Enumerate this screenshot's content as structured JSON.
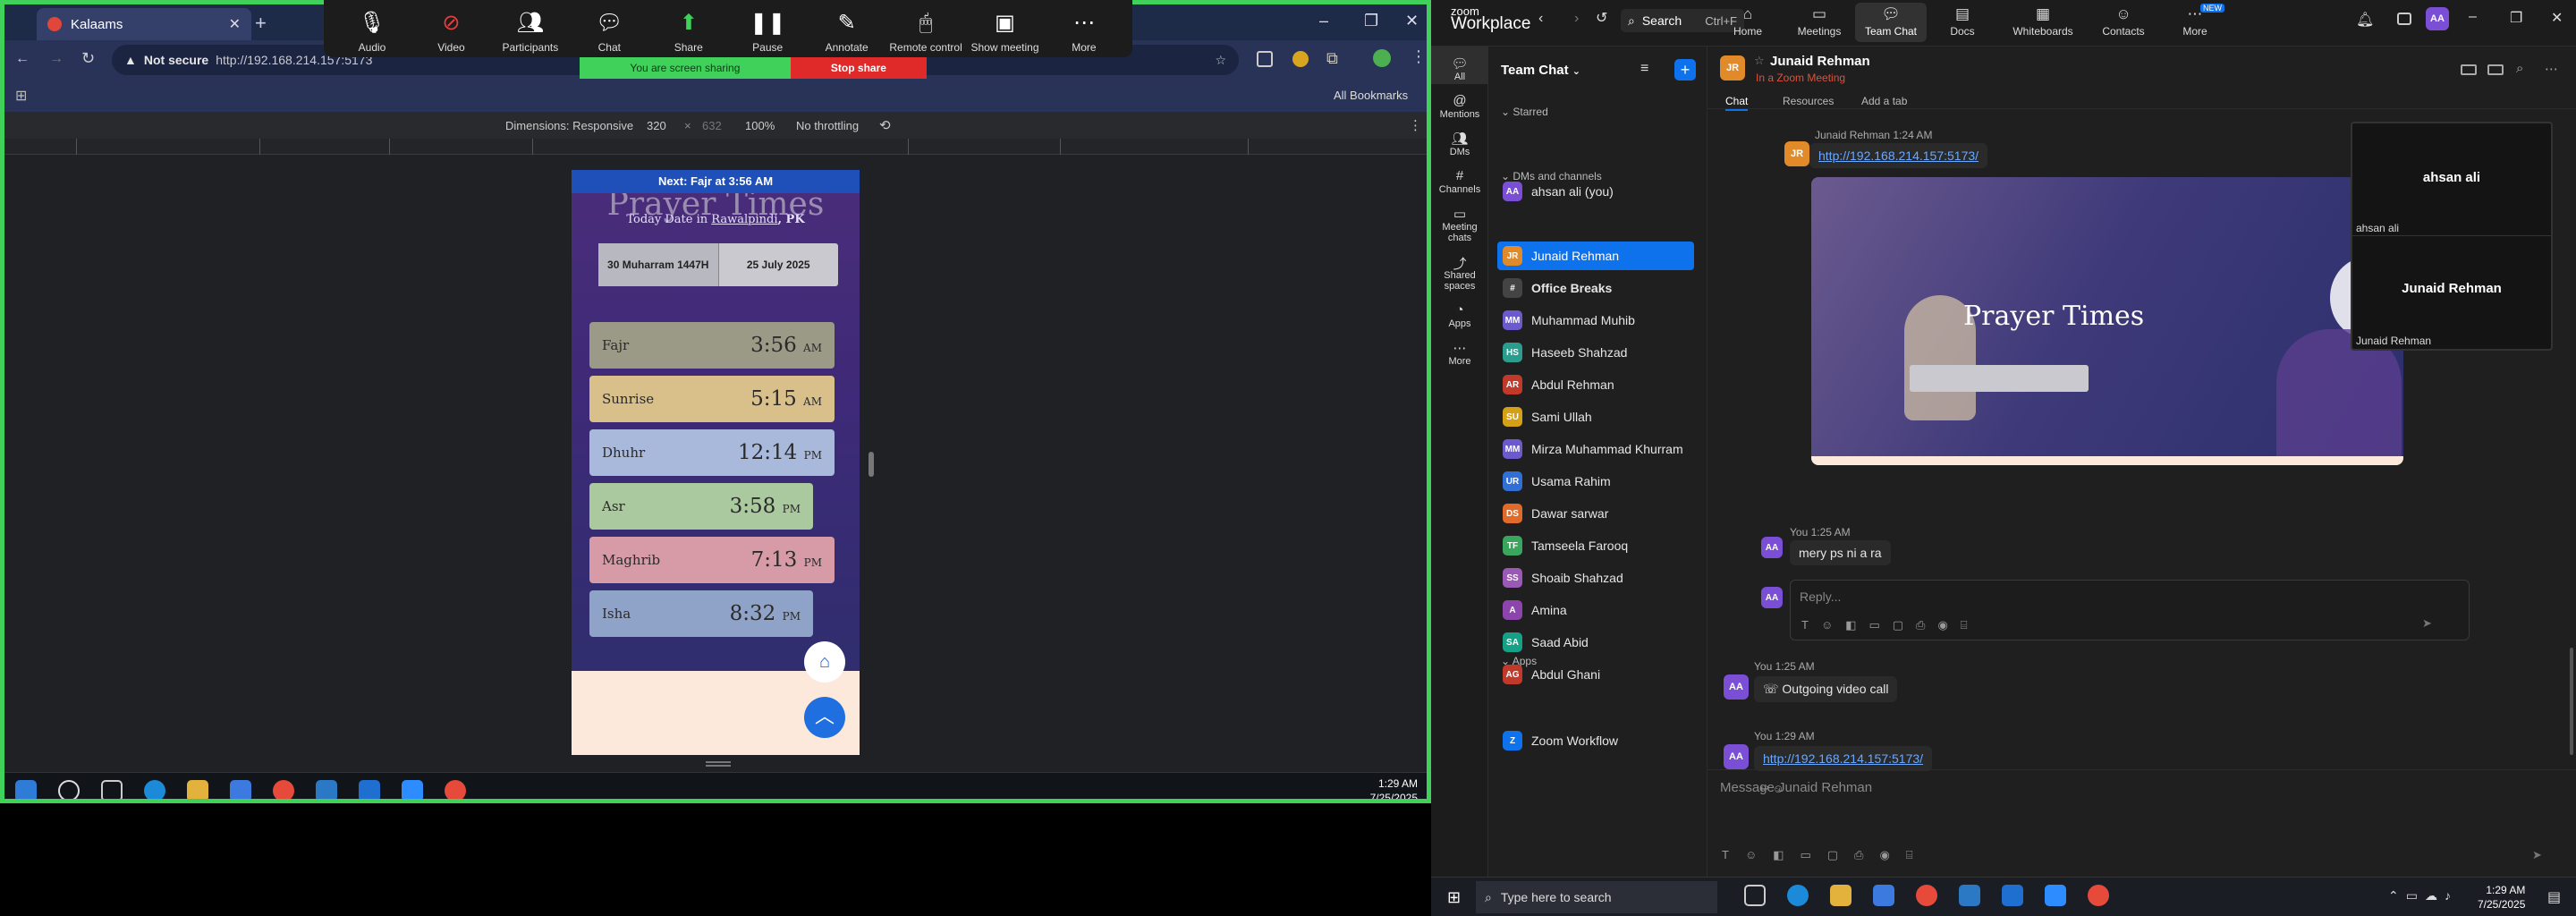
{
  "browser": {
    "tab_title": "Kalaams",
    "url_label": "Not secure",
    "url": "http://192.168.214.157:5173",
    "bookmarks": "All Bookmarks",
    "devtools": {
      "dimensions": "Dimensions: Responsive",
      "width": "320",
      "height": "632",
      "zoom": "100%",
      "throttling": "No throttling"
    }
  },
  "zoom_toolbar": {
    "items": [
      {
        "label": "Audio",
        "icon": "microphone-icon"
      },
      {
        "label": "Video",
        "icon": "video-off-icon"
      },
      {
        "label": "Participants",
        "icon": "participants-icon",
        "count": "2"
      },
      {
        "label": "Chat",
        "icon": "chat-icon"
      },
      {
        "label": "Share",
        "icon": "share-icon"
      },
      {
        "label": "Pause",
        "icon": "pause-icon"
      },
      {
        "label": "Annotate",
        "icon": "annotate-icon"
      },
      {
        "label": "Remote control",
        "icon": "remote-control-icon"
      },
      {
        "label": "Show meeting",
        "icon": "show-meeting-icon"
      },
      {
        "label": "More",
        "icon": "more-icon"
      }
    ],
    "sharing_text": "You are screen sharing",
    "stop_share": "Stop share"
  },
  "prayer_app": {
    "next_prayer": "Next: Fajr at 3:56 AM",
    "title": "Prayer Times",
    "today_prefix": "Today Date in",
    "city": "Rawalpindi",
    "country": ", PK",
    "hijri": "30 Muharram 1447H",
    "gregorian": "25 July 2025",
    "prayers": [
      {
        "name": "Fajr",
        "time": "3:56",
        "ampm": "AM",
        "color": "#9a9a86"
      },
      {
        "name": "Sunrise",
        "time": "5:15",
        "ampm": "AM",
        "color": "#d9c08a"
      },
      {
        "name": "Dhuhr",
        "time": "12:14",
        "ampm": "PM",
        "color": "#a9b9dc"
      },
      {
        "name": "Asr",
        "time": "3:58",
        "ampm": "PM",
        "color": "#aac99e"
      },
      {
        "name": "Maghrib",
        "time": "7:13",
        "ampm": "PM",
        "color": "#d79aa7"
      },
      {
        "name": "Isha",
        "time": "8:32",
        "ampm": "PM",
        "color": "#8fa3c8"
      }
    ]
  },
  "left_taskbar": {
    "time": "1:29 AM",
    "date": "7/25/2025"
  },
  "zoom": {
    "logo_top": "zoom",
    "logo_bottom": "Workplace",
    "search": "Search",
    "search_shortcut": "Ctrl+F",
    "nav": [
      {
        "label": "Home",
        "icon": "home-icon"
      },
      {
        "label": "Meetings",
        "icon": "meetings-icon"
      },
      {
        "label": "Team Chat",
        "icon": "team-chat-icon"
      },
      {
        "label": "Docs",
        "icon": "docs-icon"
      },
      {
        "label": "Whiteboards",
        "icon": "whiteboards-icon"
      },
      {
        "label": "Contacts",
        "icon": "contacts-icon"
      },
      {
        "label": "More",
        "icon": "more-icon",
        "badge": "NEW"
      }
    ],
    "rail": [
      {
        "label": "All",
        "icon": "all-icon"
      },
      {
        "label": "Mentions",
        "icon": "mentions-icon"
      },
      {
        "label": "DMs",
        "icon": "dms-icon"
      },
      {
        "label": "Channels",
        "icon": "channels-icon"
      },
      {
        "label": "Meeting chats",
        "icon": "meeting-chats-icon"
      },
      {
        "label": "Shared spaces",
        "icon": "shared-spaces-icon"
      },
      {
        "label": "Apps",
        "icon": "apps-icon"
      },
      {
        "label": "More",
        "icon": "more-icon"
      }
    ],
    "list_header": "Team Chat",
    "starred": "Starred",
    "dms_channels": "DMs and channels",
    "apps": "Apps",
    "starred_items": [
      {
        "name": "ahsan ali (you)",
        "initials": "AA",
        "color": "#7a4fd6"
      }
    ],
    "contacts": [
      {
        "name": "Junaid Rehman",
        "initials": "JR",
        "color": "#e08a2a"
      },
      {
        "name": "Office Breaks",
        "initials": "#",
        "color": "#444"
      },
      {
        "name": "Muhammad Muhib",
        "initials": "MM",
        "color": "#6a5acd"
      },
      {
        "name": "Haseeb Shahzad",
        "initials": "HS",
        "color": "#2a9d8f"
      },
      {
        "name": "Abdul Rehman",
        "initials": "AR",
        "color": "#c0392b"
      },
      {
        "name": "Sami Ullah",
        "initials": "SU",
        "color": "#d4a017"
      },
      {
        "name": "Mirza Muhammad Khurram",
        "initials": "MM",
        "color": "#6a5acd"
      },
      {
        "name": "Usama Rahim",
        "initials": "UR",
        "color": "#2f6fd6"
      },
      {
        "name": "Dawar sarwar",
        "initials": "DS",
        "color": "#e06a2a"
      },
      {
        "name": "Tamseela Farooq",
        "initials": "TF",
        "color": "#3aa55d"
      },
      {
        "name": "Shoaib Shahzad",
        "initials": "SS",
        "color": "#9b59b6"
      },
      {
        "name": "Amina",
        "initials": "A",
        "color": "#8e44ad"
      },
      {
        "name": "Saad Abid",
        "initials": "SA",
        "color": "#16a085"
      },
      {
        "name": "Abdul Ghani",
        "initials": "AG",
        "color": "#c0392b"
      }
    ],
    "app_items": [
      {
        "name": "Zoom Workflow",
        "initials": "Z",
        "color": "#0e72ed"
      }
    ],
    "chat_header": {
      "name": "Junaid Rehman",
      "status": "In a Zoom Meeting",
      "tabs": [
        "Chat",
        "Resources",
        "Add a tab"
      ]
    },
    "messages": {
      "m1_author": "Junaid Rehman",
      "m1_time": "1:24 AM",
      "m1_link": "http://192.168.214.157:5173/",
      "m2_author": "You",
      "m2_time": "1:25 AM",
      "m2_text": "mery ps ni a ra",
      "reply_placeholder": "Reply...",
      "m3_author": "You",
      "m3_time": "1:25 AM",
      "m3_text": "Outgoing video call",
      "m4_author": "You",
      "m4_time": "1:29 AM",
      "m4_link": "http://192.168.214.157:5173/",
      "composer_placeholder": "Message Junaid Rehman"
    },
    "video_panel": {
      "p1_big": "ahsan ali",
      "p1_small": "ahsan ali",
      "p2_big": "Junaid Rehman",
      "p2_small": "Junaid Rehman"
    }
  },
  "right_taskbar": {
    "search": "Type here to search",
    "time": "1:29 AM",
    "date": "7/25/2025"
  }
}
